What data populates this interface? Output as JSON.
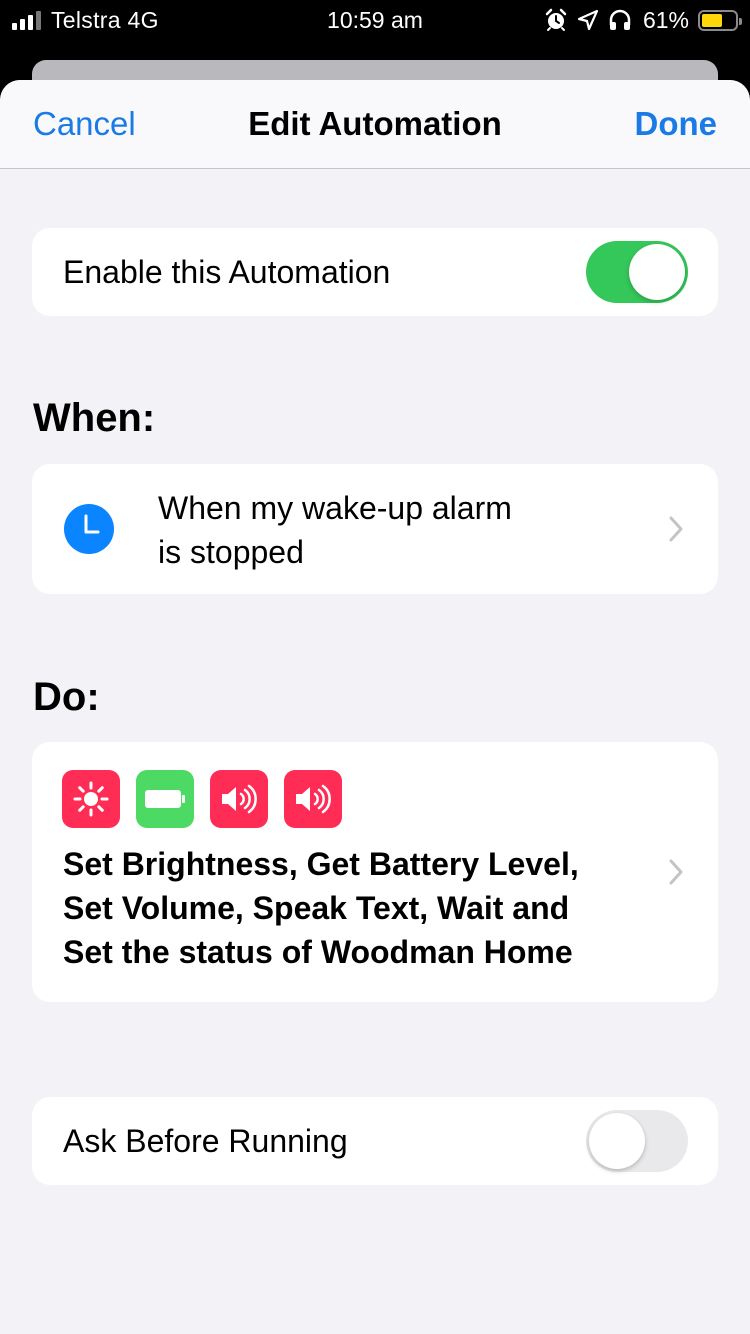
{
  "status_bar": {
    "carrier": "Telstra 4G",
    "time": "10:59 am",
    "battery_percent": "61%",
    "battery_level": 0.61,
    "icons": [
      "signal-icon",
      "alarm-icon",
      "location-arrow-icon",
      "headphones-icon",
      "battery-icon"
    ]
  },
  "nav": {
    "cancel_label": "Cancel",
    "title": "Edit Automation",
    "done_label": "Done"
  },
  "enable": {
    "label": "Enable this Automation",
    "on": true
  },
  "when": {
    "heading": "When:",
    "trigger_line1": "When my wake-up alarm",
    "trigger_line2": "is stopped",
    "icon": "clock-icon"
  },
  "do": {
    "heading": "Do:",
    "icons": [
      "brightness-icon",
      "battery-level-icon",
      "volume-icon",
      "speak-text-icon"
    ],
    "line1": "Set Brightness, Get Battery Level,",
    "line2": "Set Volume, Speak Text, Wait and",
    "line3": "Set the status of Woodman Home"
  },
  "ask": {
    "label": "Ask Before Running",
    "on": false
  },
  "colors": {
    "accent": "#1a7ae6",
    "toggle_on": "#34c759",
    "action_red": "#ff2d55",
    "action_green": "#4cd964",
    "clock_blue": "#0a84ff"
  }
}
